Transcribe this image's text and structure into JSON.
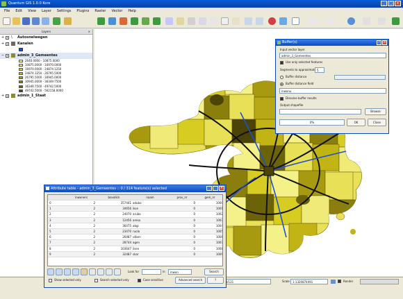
{
  "window": {
    "title": "Quantum GIS 1.0.0 Kore"
  },
  "menu": [
    "File",
    "Edit",
    "View",
    "Layer",
    "Settings",
    "Plugins",
    "Raster",
    "Vector",
    "Help"
  ],
  "layers_panel": {
    "title": "Layers",
    "items": [
      {
        "label": "Autosnelwegen",
        "checked": true,
        "expanded": false
      },
      {
        "label": "Kanalen",
        "checked": true,
        "expanded": false
      },
      {
        "label": "admin_3_Gemeentes",
        "checked": true,
        "expanded": true
      },
      {
        "label": "admin_1_Staat",
        "checked": true,
        "expanded": false
      }
    ],
    "legend": [
      {
        "range": "2640.0000 - 10875.0000",
        "color": "#f4f188"
      },
      {
        "range": "10875.0000 - 16970.0000",
        "color": "#e8e056"
      },
      {
        "range": "16970.0000 - 24874.1250",
        "color": "#d6cc22"
      },
      {
        "range": "24874.1250 - 26795.5000",
        "color": "#c2b414"
      },
      {
        "range": "26795.5000 - 30945.0000",
        "color": "#a89a10"
      },
      {
        "range": "30945.0000 - 36349.7500",
        "color": "#8a7e0c"
      },
      {
        "range": "36349.7500 - 49742.5000",
        "color": "#6c6208"
      },
      {
        "range": "49742.5000 - 562158.0000",
        "color": "#4c4406"
      }
    ]
  },
  "attribute_table": {
    "title": "Attribute table - admin_3_Gemeentes :: 0 / 314 feature(s) selected",
    "columns": [
      "inwoners",
      "bevolkin",
      "naam",
      "prov_nr",
      "gem_nr"
    ],
    "rows": [
      {
        "id": "0",
        "values": [
          "2",
          "357441",
          "adubo",
          "0",
          "1000"
        ]
      },
      {
        "id": "1",
        "values": [
          "2",
          "34656",
          "ikon",
          "0",
          "1001"
        ]
      },
      {
        "id": "2",
        "values": [
          "2",
          "24070",
          "aruba",
          "0",
          "1002"
        ]
      },
      {
        "id": "3",
        "values": [
          "2",
          "12456",
          "aresa",
          "0",
          "1003"
        ]
      },
      {
        "id": "4",
        "values": [
          "2",
          "36475",
          "abgi",
          "0",
          "1004"
        ]
      },
      {
        "id": "5",
        "values": [
          "2",
          "23470",
          "ruolo",
          "0",
          "1005"
        ]
      },
      {
        "id": "6",
        "values": [
          "2",
          "26487",
          "utbon",
          "0",
          "1006"
        ]
      },
      {
        "id": "7",
        "values": [
          "2",
          "28744",
          "agen",
          "0",
          "1007"
        ]
      },
      {
        "id": "8",
        "values": [
          "2",
          "103647",
          "ilsen",
          "0",
          "1008"
        ]
      },
      {
        "id": "9",
        "values": [
          "2",
          "32487",
          "skar",
          "0",
          "1009"
        ]
      }
    ],
    "look_for_label": "Look for",
    "in_label": "in",
    "field_value": "inwon",
    "search_label": "Search",
    "show_selected_label": "Show selected only",
    "search_selected_label": "Search selected only",
    "case_label": "Case sensitive",
    "advanced_label": "Advanced search",
    "help_label": "?"
  },
  "buffer_dialog": {
    "title": "Buffer(s)",
    "input_layer_label": "Input vector layer",
    "input_layer_value": "admin_3_Gemeentes",
    "use_selected_label": "Use only selected features",
    "segments_label": "Segments to approximate",
    "segments_value": "5",
    "buffer_distance_label": "Buffer distance",
    "buffer_field_label": "Buffer distance field",
    "field_value": "inwonu",
    "dissolve_label": "Dissolve buffer results",
    "output_label": "Output shapefile",
    "browse_label": "Browse",
    "progress": "0%",
    "ok_label": "OK",
    "close_label": "Close"
  },
  "statusbar": {
    "coordinate_label": "Coordinate:",
    "coordinate_value": "96237.2168/121",
    "scale_label": "Scale",
    "scale_value": "1:1320874491",
    "render_label": "Render"
  },
  "colors": {
    "accent": "#0a4bc0",
    "road": "#111111",
    "canal": "#1f4fd0",
    "map_dark": "#7a6c0a",
    "map_light": "#eee86a"
  }
}
